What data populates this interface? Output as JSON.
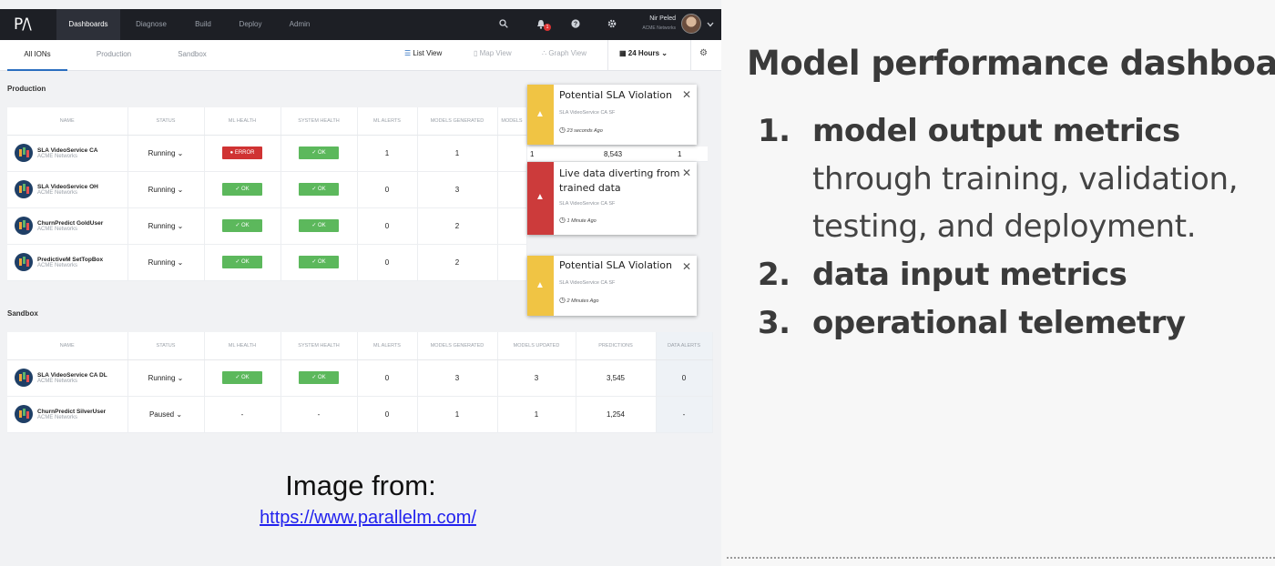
{
  "app": {
    "logo": "P/\\",
    "nav": [
      "Dashboards",
      "Diagnose",
      "Build",
      "Deploy",
      "Admin"
    ],
    "notification_count": "1",
    "user_name": "Nir Peled",
    "user_org": "ACME Networks"
  },
  "subnav": {
    "tabs": [
      "All IONs",
      "Production",
      "Sandbox"
    ],
    "views": [
      "List View",
      "Map View",
      "Graph View"
    ],
    "time_range": "24 Hours"
  },
  "production": {
    "title": "Production",
    "headers": [
      "NAME",
      "STATUS",
      "ML HEALTH",
      "SYSTEM HEALTH",
      "ML ALERTS",
      "MODELS GENERATED",
      "MODELS"
    ],
    "rows": [
      {
        "name": "SLA VideoService CA",
        "org": "ACME Networks",
        "status": "Running",
        "ml_health": "ERROR",
        "sys_health": "OK",
        "ml_alerts": "1",
        "models_generated": "1"
      },
      {
        "name": "SLA VideoService OH",
        "org": "ACME Networks",
        "status": "Running",
        "ml_health": "OK",
        "sys_health": "OK",
        "ml_alerts": "0",
        "models_generated": "3"
      },
      {
        "name": "ChurnPredict GoldUser",
        "org": "ACME Networks",
        "status": "Running",
        "ml_health": "OK",
        "sys_health": "OK",
        "ml_alerts": "0",
        "models_generated": "2"
      },
      {
        "name": "PredictiveM SetTopBox",
        "org": "ACME Networks",
        "status": "Running",
        "ml_health": "OK",
        "sys_health": "OK",
        "ml_alerts": "0",
        "models_generated": "2"
      }
    ],
    "peek_row": {
      "models_updated": "1",
      "predictions": "8,543",
      "data_alerts": "1"
    }
  },
  "sandbox": {
    "title": "Sandbox",
    "headers": [
      "NAME",
      "STATUS",
      "ML HEALTH",
      "SYSTEM HEALTH",
      "ML ALERTS",
      "MODELS GENERATED",
      "MODELS UPDATED",
      "PREDICTIONS",
      "DATA ALERTS"
    ],
    "rows": [
      {
        "name": "SLA VideoService CA DL",
        "org": "ACME Networks",
        "status": "Running",
        "ml_health": "OK",
        "sys_health": "OK",
        "ml_alerts": "0",
        "models_generated": "3",
        "models_updated": "3",
        "predictions": "3,545",
        "data_alerts": "0"
      },
      {
        "name": "ChurnPredict SilverUser",
        "org": "ACME Networks",
        "status": "Paused",
        "ml_health": "-",
        "sys_health": "-",
        "ml_alerts": "0",
        "models_generated": "1",
        "models_updated": "1",
        "predictions": "1,254",
        "data_alerts": "-"
      }
    ]
  },
  "notifications": [
    {
      "title": "Potential SLA Violation",
      "source": "SLA VideoService CA SF",
      "time": "23 seconds Ago",
      "severity": "warning"
    },
    {
      "title": "Live data diverting from trained data",
      "source": "SLA VideoService CA SF",
      "time": "1 Minute Ago",
      "severity": "critical"
    },
    {
      "title": "Potential SLA Violation",
      "source": "SLA VideoService CA SF",
      "time": "2 Minutes Ago",
      "severity": "warning"
    }
  ],
  "caption": {
    "image_from": "Image from:",
    "link": "https://www.parallelm.com/"
  },
  "slide": {
    "title": "Model performance dashboard",
    "items": [
      {
        "num": "1.",
        "bold": "model output metrics",
        "sub": [
          "through training, validation,",
          "testing, and deployment."
        ]
      },
      {
        "num": "2.",
        "bold": "data input metrics"
      },
      {
        "num": "3.",
        "bold": "operational telemetry"
      }
    ]
  },
  "colors": {
    "ok": "#5cb85c",
    "error": "#d03333",
    "warning": "#f0c444",
    "critical": "#cc3b3b",
    "topbar": "#1d1f25"
  }
}
